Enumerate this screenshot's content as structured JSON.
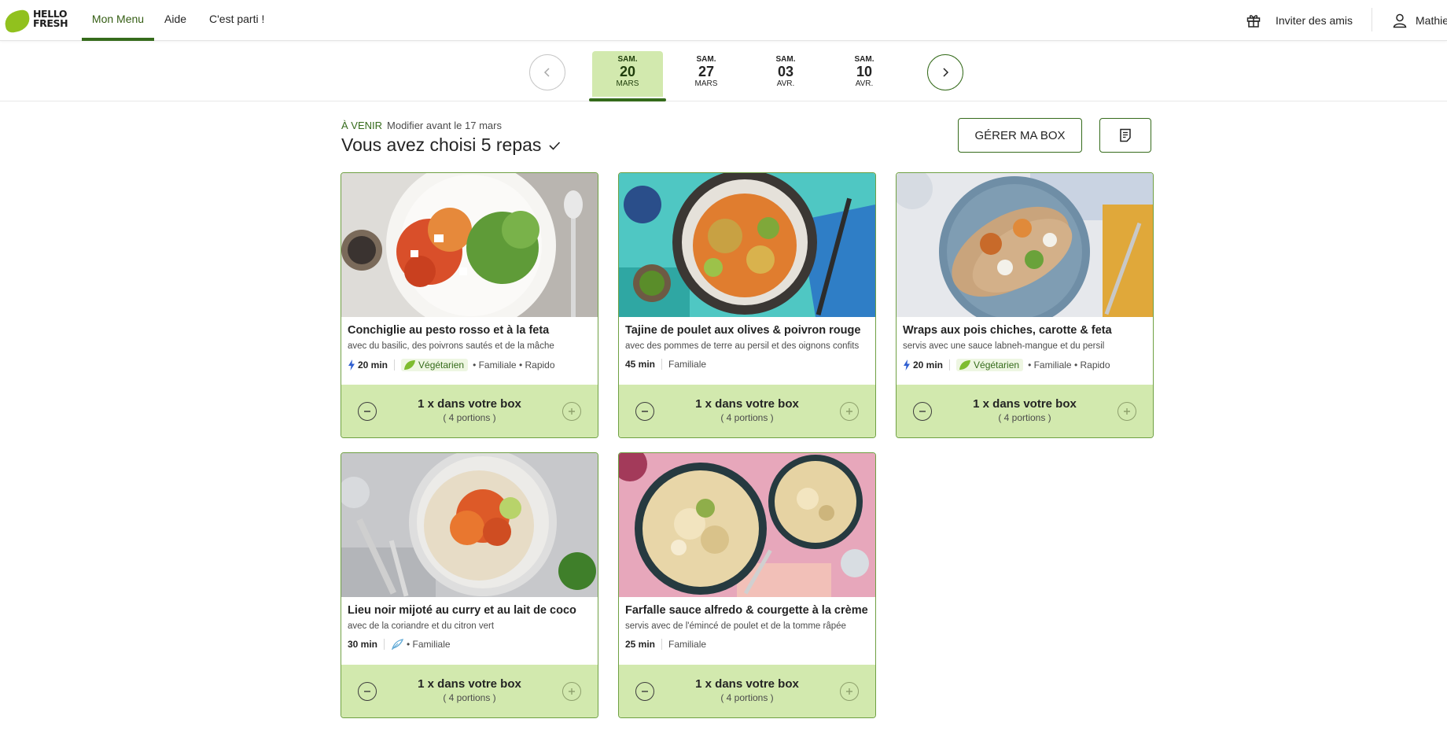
{
  "brand": {
    "line1": "HELLO",
    "line2": "FRESH"
  },
  "nav": {
    "items": [
      "Mon Menu",
      "Aide",
      "C'est parti !"
    ]
  },
  "header": {
    "invite_label": "Inviter des amis",
    "user_name": "Mathie"
  },
  "weeks": [
    {
      "day": "SAM.",
      "num": "20",
      "month": "MARS",
      "selected": true
    },
    {
      "day": "SAM.",
      "num": "27",
      "month": "MARS",
      "selected": false
    },
    {
      "day": "SAM.",
      "num": "03",
      "month": "AVR.",
      "selected": false
    },
    {
      "day": "SAM.",
      "num": "10",
      "month": "AVR.",
      "selected": false
    }
  ],
  "summary": {
    "status": "À VENIR",
    "deadline": "Modifier avant le 17 mars",
    "title": "Vous avez choisi 5 repas",
    "manage_label": "GÉRER MA BOX"
  },
  "recipes": [
    {
      "title": "Conchiglie au pesto rosso et à la feta",
      "subtitle": "avec du basilic, des poivrons sautés et de la mâche",
      "time": "20 min",
      "quick": true,
      "diet": "Végétarien",
      "tags": "• Familiale • Rapido",
      "quantity": "1 x dans votre box",
      "portions": "( 4 portions )"
    },
    {
      "title": "Tajine de poulet aux olives & poivron rouge",
      "subtitle": "avec des pommes de terre au persil et des oignons confits",
      "time": "45 min",
      "quick": false,
      "diet": "",
      "tags": "Familiale",
      "quantity": "1 x dans votre box",
      "portions": "( 4 portions )"
    },
    {
      "title": "Wraps aux pois chiches, carotte & feta",
      "subtitle": "servis avec une sauce labneh-mangue et du persil",
      "time": "20 min",
      "quick": true,
      "diet": "Végétarien",
      "tags": "• Familiale • Rapido",
      "quantity": "1 x dans votre box",
      "portions": "( 4 portions )"
    },
    {
      "title": "Lieu noir mijoté au curry et au lait de coco",
      "subtitle": "avec de la coriandre et du citron vert",
      "time": "30 min",
      "quick": false,
      "diet": "",
      "tags": "• Familiale",
      "quantity": "1 x dans votre box",
      "portions": "( 4 portions )"
    },
    {
      "title": "Farfalle sauce alfredo & courgette à la crème",
      "subtitle": "servis avec de l'émincé de poulet et de la tomme râpée",
      "time": "25 min",
      "quick": false,
      "diet": "",
      "tags": "Familiale",
      "quantity": "1 x dans votre box",
      "portions": "( 4 portions )"
    }
  ],
  "colors": {
    "brand_green": "#356b1b",
    "light_green": "#d2e9ae",
    "logo_green": "#91c11e"
  }
}
